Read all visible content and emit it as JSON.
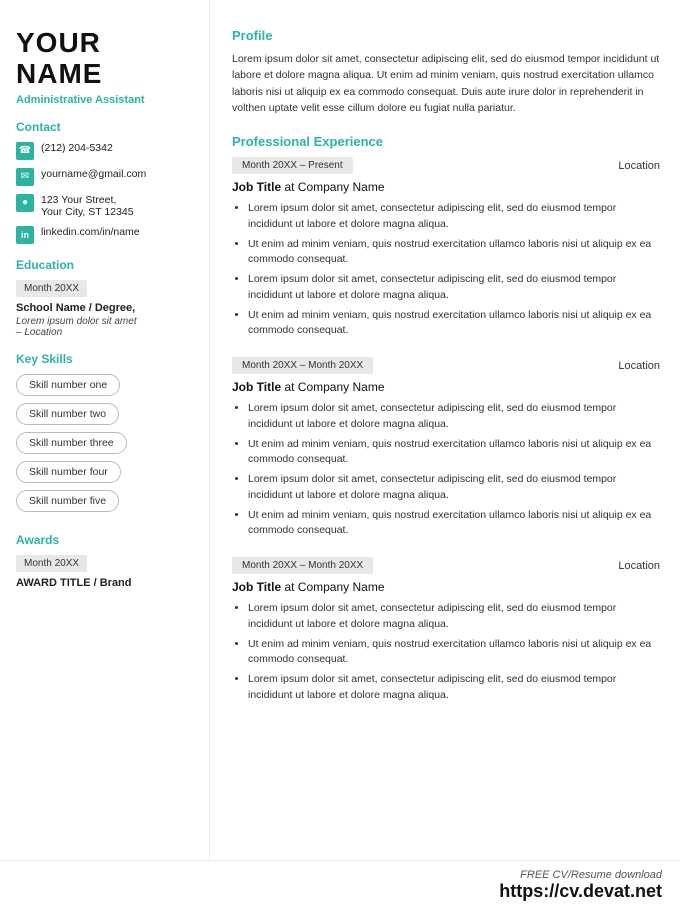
{
  "left": {
    "name_line1": "YOUR",
    "name_line2": "NAME",
    "job_title": "Administrative Assistant",
    "contact_label": "Contact",
    "contact_items": [
      {
        "icon": "phone",
        "text": "(212) 204-5342"
      },
      {
        "icon": "email",
        "text": "yourname@gmail.com"
      },
      {
        "icon": "location",
        "text": "123 Your Street,\nYour City, ST 12345"
      },
      {
        "icon": "linkedin",
        "text": "linkedin.com/in/name"
      }
    ],
    "education_label": "Education",
    "edu_date": "Month 20XX",
    "school_name": "School Name / Degree,",
    "school_detail": "Lorem ipsum dolor sit amet\n– Location",
    "skills_label": "Key Skills",
    "skills": [
      "Skill number one",
      "Skill number two",
      "Skill number three",
      "Skill number four",
      "Skill number five"
    ],
    "awards_label": "Awards",
    "awards_date": "Month 20XX",
    "award_title": "AWARD TITLE / Brand"
  },
  "right": {
    "profile_label": "Profile",
    "profile_text": "Lorem ipsum dolor sit amet, consectetur adipiscing elit, sed do eiusmod tempor incididunt ut labore et dolore magna aliqua. Ut enim ad minim veniam, quis nostrud exercitation ullamco laboris nisi ut aliquip ex ea commodo consequat. Duis aute irure dolor in reprehenderit in volthen uptate velit esse cillum dolore eu fugiat nulla pariatur.",
    "exp_label": "Professional Experience",
    "experiences": [
      {
        "date": "Month 20XX – Present",
        "location": "Location",
        "job_title": "Job Title",
        "company": "Company Name",
        "bullets": [
          "Lorem ipsum dolor sit amet, consectetur adipiscing elit, sed do eiusmod tempor incididunt ut labore et dolore magna aliqua.",
          "Ut enim ad minim veniam, quis nostrud exercitation ullamco laboris nisi ut aliquip ex ea commodo consequat.",
          "Lorem ipsum dolor sit amet, consectetur adipiscing elit, sed do eiusmod tempor incididunt ut labore et dolore magna aliqua.",
          "Ut enim ad minim veniam, quis nostrud exercitation ullamco laboris nisi ut aliquip ex ea commodo consequat."
        ]
      },
      {
        "date": "Month 20XX – Month 20XX",
        "location": "Location",
        "job_title": "Job Title",
        "company": "Company Name",
        "bullets": [
          "Lorem ipsum dolor sit amet, consectetur adipiscing elit, sed do eiusmod tempor incididunt ut labore et dolore magna aliqua.",
          "Ut enim ad minim veniam, quis nostrud exercitation ullamco laboris nisi ut aliquip ex ea commodo consequat.",
          "Lorem ipsum dolor sit amet, consectetur adipiscing elit, sed do eiusmod tempor incididunt ut labore et dolore magna aliqua.",
          "Ut enim ad minim veniam, quis nostrud exercitation ullamco laboris nisi ut aliquip ex ea commodo consequat."
        ]
      },
      {
        "date": "Month 20XX – Month 20XX",
        "location": "Location",
        "job_title": "Job Title",
        "company": "Company Name",
        "bullets": [
          "Lorem ipsum dolor sit amet, consectetur adipiscing elit, sed do eiusmod tempor incididunt ut labore et dolore magna aliqua.",
          "Ut enim ad minim veniam, quis nostrud exercitation ullamco laboris nisi ut aliquip ex ea commodo consequat.",
          "Lorem ipsum dolor sit amet, consectetur adipiscing elit, sed do eiusmod tempor incididunt ut labore et dolore magna aliqua."
        ]
      }
    ]
  },
  "footer": {
    "label": "FREE CV/Resume download",
    "url": "https://cv.devat.net"
  }
}
